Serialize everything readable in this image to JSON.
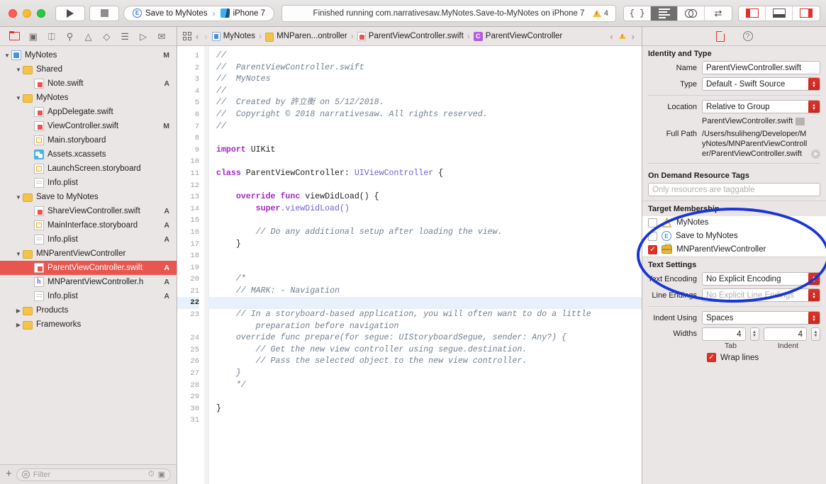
{
  "window": {
    "traffic_lights": [
      "close",
      "minimize",
      "zoom"
    ]
  },
  "toolbar": {
    "run_label": "Run",
    "stop_label": "Stop",
    "scheme": {
      "target": "Save to MyNotes",
      "target_badge": "E",
      "separator": "›",
      "device": "iPhone 7"
    },
    "status": "Finished running com.narrativesaw.MyNotes.Save-to-MyNotes on iPhone 7",
    "warning_count": "4",
    "editor_segments": [
      {
        "name": "related-items",
        "glyph": "{}"
      },
      {
        "name": "standard-editor",
        "active": true
      },
      {
        "name": "assistant-editor",
        "active": false
      },
      {
        "name": "version-editor",
        "glyph": "⇄",
        "active": false
      }
    ],
    "panel_buttons": [
      {
        "name": "toggle-navigator",
        "state": "on"
      },
      {
        "name": "toggle-debug-area",
        "state": "off"
      },
      {
        "name": "toggle-inspector",
        "state": "on"
      }
    ]
  },
  "navigator": {
    "tabs": [
      "project-navigator",
      "source-control-navigator",
      "symbol-navigator",
      "find-navigator",
      "issue-navigator",
      "test-navigator",
      "debug-navigator",
      "breakpoint-navigator",
      "report-navigator"
    ],
    "tree": [
      {
        "label": "MyNotes",
        "indent": 0,
        "icon": "project",
        "twisty": "down",
        "status": "M",
        "selected": false
      },
      {
        "label": "Shared",
        "indent": 1,
        "icon": "folder",
        "twisty": "down",
        "status": "",
        "selected": false
      },
      {
        "label": "Note.swift",
        "indent": 2,
        "icon": "swift",
        "twisty": "",
        "status": "A",
        "selected": false
      },
      {
        "label": "MyNotes",
        "indent": 1,
        "icon": "folder",
        "twisty": "down",
        "status": "",
        "selected": false
      },
      {
        "label": "AppDelegate.swift",
        "indent": 2,
        "icon": "swift",
        "twisty": "",
        "status": "",
        "selected": false
      },
      {
        "label": "ViewController.swift",
        "indent": 2,
        "icon": "swift",
        "twisty": "",
        "status": "M",
        "selected": false
      },
      {
        "label": "Main.storyboard",
        "indent": 2,
        "icon": "storyboard",
        "twisty": "",
        "status": "",
        "selected": false
      },
      {
        "label": "Assets.xcassets",
        "indent": 2,
        "icon": "xcassets",
        "twisty": "",
        "status": "",
        "selected": false
      },
      {
        "label": "LaunchScreen.storyboard",
        "indent": 2,
        "icon": "storyboard",
        "twisty": "",
        "status": "",
        "selected": false
      },
      {
        "label": "Info.plist",
        "indent": 2,
        "icon": "plist",
        "twisty": "",
        "status": "",
        "selected": false
      },
      {
        "label": "Save to MyNotes",
        "indent": 1,
        "icon": "folder",
        "twisty": "down",
        "status": "",
        "selected": false
      },
      {
        "label": "ShareViewController.swift",
        "indent": 2,
        "icon": "swift",
        "twisty": "",
        "status": "A",
        "selected": false
      },
      {
        "label": "MainInterface.storyboard",
        "indent": 2,
        "icon": "storyboard",
        "twisty": "",
        "status": "A",
        "selected": false
      },
      {
        "label": "Info.plist",
        "indent": 2,
        "icon": "plist",
        "twisty": "",
        "status": "A",
        "selected": false
      },
      {
        "label": "MNParentViewController",
        "indent": 1,
        "icon": "folder",
        "twisty": "down",
        "status": "",
        "selected": false
      },
      {
        "label": "ParentViewController.swift",
        "indent": 2,
        "icon": "swift",
        "twisty": "",
        "status": "A",
        "selected": true
      },
      {
        "label": "MNParentViewController.h",
        "indent": 2,
        "icon": "header",
        "twisty": "",
        "status": "A",
        "selected": false
      },
      {
        "label": "Info.plist",
        "indent": 2,
        "icon": "plist",
        "twisty": "",
        "status": "A",
        "selected": false
      },
      {
        "label": "Products",
        "indent": 1,
        "icon": "folder",
        "twisty": "right",
        "status": "",
        "selected": false
      },
      {
        "label": "Frameworks",
        "indent": 1,
        "icon": "folder",
        "twisty": "right",
        "status": "",
        "selected": false
      }
    ],
    "filter_placeholder": "Filter",
    "add_label": "+"
  },
  "editor": {
    "breadcrumbs": [
      {
        "label": "MyNotes",
        "icon": "project"
      },
      {
        "label": "MNParen...ontroller",
        "icon": "folder"
      },
      {
        "label": "ParentViewController.swift",
        "icon": "swift"
      },
      {
        "label": "ParentViewController",
        "icon": "class"
      }
    ],
    "current_line": 22,
    "total_lines": 31,
    "code_lines": [
      {
        "n": 1,
        "segs": [
          {
            "t": "//",
            "c": "cmt"
          }
        ]
      },
      {
        "n": 2,
        "segs": [
          {
            "t": "//  ParentViewController.swift",
            "c": "cmt"
          }
        ]
      },
      {
        "n": 3,
        "segs": [
          {
            "t": "//  MyNotes",
            "c": "cmt"
          }
        ]
      },
      {
        "n": 4,
        "segs": [
          {
            "t": "//",
            "c": "cmt"
          }
        ]
      },
      {
        "n": 5,
        "segs": [
          {
            "t": "//  Created by 許立衡 on 5/12/2018.",
            "c": "cmt"
          }
        ]
      },
      {
        "n": 6,
        "segs": [
          {
            "t": "//  Copyright © 2018 narrativesaw. All rights reserved.",
            "c": "cmt"
          }
        ]
      },
      {
        "n": 7,
        "segs": [
          {
            "t": "//",
            "c": "cmt"
          }
        ]
      },
      {
        "n": 8,
        "segs": []
      },
      {
        "n": 9,
        "segs": [
          {
            "t": "import",
            "c": "kw"
          },
          {
            "t": " UIKit",
            "c": "pln"
          }
        ]
      },
      {
        "n": 10,
        "segs": []
      },
      {
        "n": 11,
        "segs": [
          {
            "t": "class",
            "c": "kw"
          },
          {
            "t": " ParentViewController: ",
            "c": "pln"
          },
          {
            "t": "UIViewController",
            "c": "typ"
          },
          {
            "t": " {",
            "c": "pln"
          }
        ]
      },
      {
        "n": 12,
        "segs": []
      },
      {
        "n": 13,
        "segs": [
          {
            "t": "    ",
            "c": "pln"
          },
          {
            "t": "override func",
            "c": "kw"
          },
          {
            "t": " viewDidLoad() {",
            "c": "pln"
          }
        ]
      },
      {
        "n": 14,
        "segs": [
          {
            "t": "        ",
            "c": "pln"
          },
          {
            "t": "super",
            "c": "kw"
          },
          {
            "t": ".viewDidLoad()",
            "c": "typ"
          }
        ]
      },
      {
        "n": 15,
        "segs": []
      },
      {
        "n": 16,
        "segs": [
          {
            "t": "        // Do any additional setup after loading the view.",
            "c": "cmt"
          }
        ]
      },
      {
        "n": 17,
        "segs": [
          {
            "t": "    }",
            "c": "pln"
          }
        ]
      },
      {
        "n": 18,
        "segs": []
      },
      {
        "n": 19,
        "segs": []
      },
      {
        "n": 20,
        "segs": [
          {
            "t": "    /*",
            "c": "cmt"
          }
        ]
      },
      {
        "n": 21,
        "segs": [
          {
            "t": "    // MARK: - Navigation",
            "c": "cmt"
          }
        ]
      },
      {
        "n": 22,
        "segs": []
      },
      {
        "n": 23,
        "segs": [
          {
            "t": "    // In a storyboard-based application, you will often want to do a little",
            "c": "cmt"
          }
        ]
      },
      {
        "n": "",
        "segs": [
          {
            "t": "        preparation before navigation",
            "c": "cmt"
          }
        ]
      },
      {
        "n": 24,
        "segs": [
          {
            "t": "    override func prepare(for segue: UIStoryboardSegue, sender: Any?) {",
            "c": "cmt"
          }
        ]
      },
      {
        "n": 25,
        "segs": [
          {
            "t": "        // Get the new view controller using segue.destination.",
            "c": "cmt"
          }
        ]
      },
      {
        "n": 26,
        "segs": [
          {
            "t": "        // Pass the selected object to the new view controller.",
            "c": "cmt"
          }
        ]
      },
      {
        "n": 27,
        "segs": [
          {
            "t": "    }",
            "c": "cmt"
          }
        ]
      },
      {
        "n": 28,
        "segs": [
          {
            "t": "    */",
            "c": "cmt"
          }
        ]
      },
      {
        "n": 29,
        "segs": []
      },
      {
        "n": 30,
        "segs": [
          {
            "t": "}",
            "c": "pln"
          }
        ]
      },
      {
        "n": 31,
        "segs": []
      }
    ]
  },
  "inspector": {
    "tabs": [
      "file-inspector",
      "quick-help-inspector"
    ],
    "identity_and_type": {
      "title": "Identity and Type",
      "name_label": "Name",
      "name_value": "ParentViewController.swift",
      "type_label": "Type",
      "type_value": "Default - Swift Source",
      "location_label": "Location",
      "location_value": "Relative to Group",
      "location_file": "ParentViewController.swift",
      "full_path_label": "Full Path",
      "full_path_value": "/Users/hsuliheng/Developer/MyNotes/MNParentViewController/ParentViewController.swift"
    },
    "on_demand_resource_tags": {
      "title": "On Demand Resource Tags",
      "placeholder": "Only resources are taggable"
    },
    "target_membership": {
      "title": "Target Membership",
      "items": [
        {
          "label": "MyNotes",
          "checked": false,
          "icon": "app"
        },
        {
          "label": "Save to MyNotes",
          "checked": false,
          "icon": "extension"
        },
        {
          "label": "MNParentViewController",
          "checked": true,
          "icon": "framework"
        }
      ]
    },
    "text_settings": {
      "title": "Text Settings",
      "text_encoding_label": "Text Encoding",
      "text_encoding_value": "No Explicit Encoding",
      "line_endings_label": "Line Endings",
      "line_endings_value": "No Explicit Line Endings",
      "indent_using_label": "Indent Using",
      "indent_using_value": "Spaces",
      "widths_label": "Widths",
      "tab_value": "4",
      "indent_value": "4",
      "tab_sublabel": "Tab",
      "indent_sublabel": "Indent",
      "wrap_lines_label": "Wrap lines",
      "wrap_lines_checked": true
    }
  },
  "annotation": {
    "shape": "ellipse",
    "color": "#1836d8",
    "highlights": "Target Membership"
  }
}
